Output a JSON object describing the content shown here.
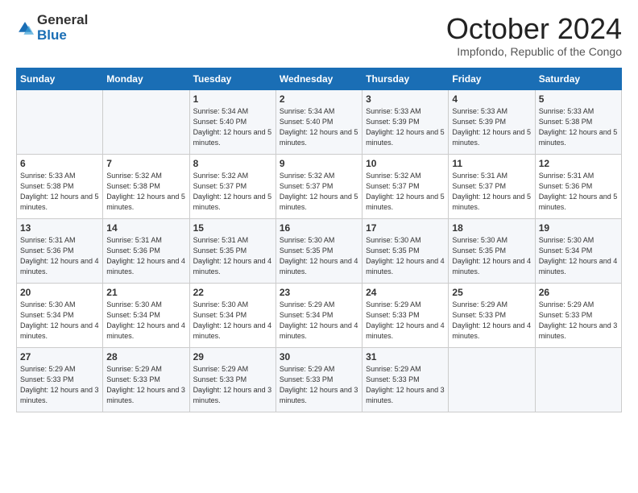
{
  "logo": {
    "general": "General",
    "blue": "Blue"
  },
  "title": "October 2024",
  "location": "Impfondo, Republic of the Congo",
  "days_of_week": [
    "Sunday",
    "Monday",
    "Tuesday",
    "Wednesday",
    "Thursday",
    "Friday",
    "Saturday"
  ],
  "weeks": [
    [
      {
        "day": "",
        "info": ""
      },
      {
        "day": "",
        "info": ""
      },
      {
        "day": "1",
        "info": "Sunrise: 5:34 AM\nSunset: 5:40 PM\nDaylight: 12 hours and 5 minutes."
      },
      {
        "day": "2",
        "info": "Sunrise: 5:34 AM\nSunset: 5:40 PM\nDaylight: 12 hours and 5 minutes."
      },
      {
        "day": "3",
        "info": "Sunrise: 5:33 AM\nSunset: 5:39 PM\nDaylight: 12 hours and 5 minutes."
      },
      {
        "day": "4",
        "info": "Sunrise: 5:33 AM\nSunset: 5:39 PM\nDaylight: 12 hours and 5 minutes."
      },
      {
        "day": "5",
        "info": "Sunrise: 5:33 AM\nSunset: 5:38 PM\nDaylight: 12 hours and 5 minutes."
      }
    ],
    [
      {
        "day": "6",
        "info": "Sunrise: 5:33 AM\nSunset: 5:38 PM\nDaylight: 12 hours and 5 minutes."
      },
      {
        "day": "7",
        "info": "Sunrise: 5:32 AM\nSunset: 5:38 PM\nDaylight: 12 hours and 5 minutes."
      },
      {
        "day": "8",
        "info": "Sunrise: 5:32 AM\nSunset: 5:37 PM\nDaylight: 12 hours and 5 minutes."
      },
      {
        "day": "9",
        "info": "Sunrise: 5:32 AM\nSunset: 5:37 PM\nDaylight: 12 hours and 5 minutes."
      },
      {
        "day": "10",
        "info": "Sunrise: 5:32 AM\nSunset: 5:37 PM\nDaylight: 12 hours and 5 minutes."
      },
      {
        "day": "11",
        "info": "Sunrise: 5:31 AM\nSunset: 5:37 PM\nDaylight: 12 hours and 5 minutes."
      },
      {
        "day": "12",
        "info": "Sunrise: 5:31 AM\nSunset: 5:36 PM\nDaylight: 12 hours and 5 minutes."
      }
    ],
    [
      {
        "day": "13",
        "info": "Sunrise: 5:31 AM\nSunset: 5:36 PM\nDaylight: 12 hours and 4 minutes."
      },
      {
        "day": "14",
        "info": "Sunrise: 5:31 AM\nSunset: 5:36 PM\nDaylight: 12 hours and 4 minutes."
      },
      {
        "day": "15",
        "info": "Sunrise: 5:31 AM\nSunset: 5:35 PM\nDaylight: 12 hours and 4 minutes."
      },
      {
        "day": "16",
        "info": "Sunrise: 5:30 AM\nSunset: 5:35 PM\nDaylight: 12 hours and 4 minutes."
      },
      {
        "day": "17",
        "info": "Sunrise: 5:30 AM\nSunset: 5:35 PM\nDaylight: 12 hours and 4 minutes."
      },
      {
        "day": "18",
        "info": "Sunrise: 5:30 AM\nSunset: 5:35 PM\nDaylight: 12 hours and 4 minutes."
      },
      {
        "day": "19",
        "info": "Sunrise: 5:30 AM\nSunset: 5:34 PM\nDaylight: 12 hours and 4 minutes."
      }
    ],
    [
      {
        "day": "20",
        "info": "Sunrise: 5:30 AM\nSunset: 5:34 PM\nDaylight: 12 hours and 4 minutes."
      },
      {
        "day": "21",
        "info": "Sunrise: 5:30 AM\nSunset: 5:34 PM\nDaylight: 12 hours and 4 minutes."
      },
      {
        "day": "22",
        "info": "Sunrise: 5:30 AM\nSunset: 5:34 PM\nDaylight: 12 hours and 4 minutes."
      },
      {
        "day": "23",
        "info": "Sunrise: 5:29 AM\nSunset: 5:34 PM\nDaylight: 12 hours and 4 minutes."
      },
      {
        "day": "24",
        "info": "Sunrise: 5:29 AM\nSunset: 5:33 PM\nDaylight: 12 hours and 4 minutes."
      },
      {
        "day": "25",
        "info": "Sunrise: 5:29 AM\nSunset: 5:33 PM\nDaylight: 12 hours and 4 minutes."
      },
      {
        "day": "26",
        "info": "Sunrise: 5:29 AM\nSunset: 5:33 PM\nDaylight: 12 hours and 3 minutes."
      }
    ],
    [
      {
        "day": "27",
        "info": "Sunrise: 5:29 AM\nSunset: 5:33 PM\nDaylight: 12 hours and 3 minutes."
      },
      {
        "day": "28",
        "info": "Sunrise: 5:29 AM\nSunset: 5:33 PM\nDaylight: 12 hours and 3 minutes."
      },
      {
        "day": "29",
        "info": "Sunrise: 5:29 AM\nSunset: 5:33 PM\nDaylight: 12 hours and 3 minutes."
      },
      {
        "day": "30",
        "info": "Sunrise: 5:29 AM\nSunset: 5:33 PM\nDaylight: 12 hours and 3 minutes."
      },
      {
        "day": "31",
        "info": "Sunrise: 5:29 AM\nSunset: 5:33 PM\nDaylight: 12 hours and 3 minutes."
      },
      {
        "day": "",
        "info": ""
      },
      {
        "day": "",
        "info": ""
      }
    ]
  ]
}
